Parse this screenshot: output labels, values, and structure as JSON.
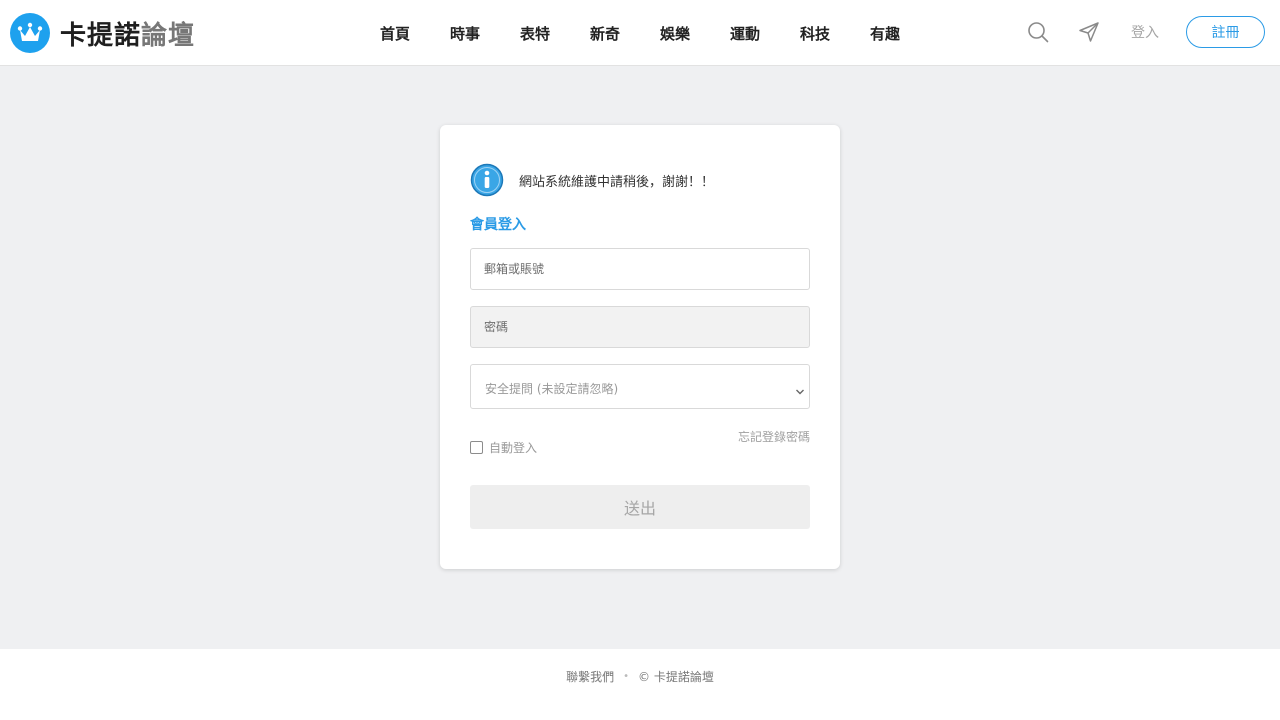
{
  "header": {
    "logo_text_bold": "卡提諾",
    "logo_text_light": "論壇",
    "nav": [
      "首頁",
      "時事",
      "表特",
      "新奇",
      "娛樂",
      "運動",
      "科技",
      "有趣"
    ],
    "login_label": "登入",
    "register_label": "註冊"
  },
  "login_card": {
    "notice": "網站系統維護中請稍後，謝謝！！",
    "title": "會員登入",
    "email_placeholder": "郵箱或賬號",
    "password_placeholder": "密碼",
    "security_question": "安全提問 (未設定請忽略)",
    "forgot_password": "忘記登錄密碼",
    "remember_me": "自動登入",
    "submit_label": "送出"
  },
  "footer": {
    "contact_label": "聯繫我們",
    "copyright": "© 卡提諾論壇"
  },
  "colors": {
    "accent": "#2b9be6",
    "logo_blue": "#1ea1ee",
    "page_background": "#eff0f2"
  },
  "icons": [
    "crown-icon",
    "search-icon",
    "send-icon",
    "info-icon",
    "chevron-down-icon"
  ]
}
